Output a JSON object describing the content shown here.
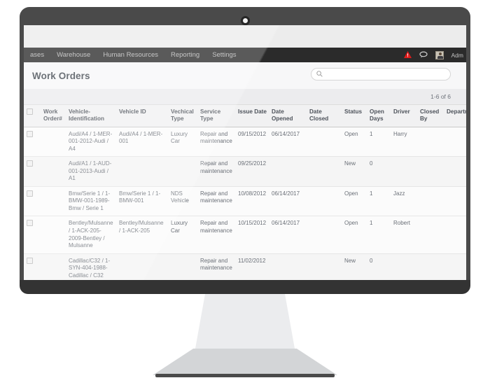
{
  "device": {
    "webcam_icon": "webcam-dot-icon"
  },
  "nav": {
    "items": [
      {
        "label": "ases"
      },
      {
        "label": "Warehouse"
      },
      {
        "label": "Human Resources"
      },
      {
        "label": "Reporting"
      },
      {
        "label": "Settings"
      }
    ],
    "right": {
      "warning_icon": "warning-triangle-icon",
      "warning_color": "#e01b1b",
      "chat_icon": "chat-bubble-icon",
      "avatar_icon": "user-avatar-icon",
      "user_label": "Adm"
    }
  },
  "page": {
    "title": "Work Orders",
    "search": {
      "icon": "search-icon",
      "value": "",
      "placeholder": ""
    },
    "pagination": "1-6 of 6"
  },
  "table": {
    "select_all_checkbox": "select-all-checkbox",
    "columns": [
      "",
      "Work Order#",
      "Vehicle-Identification",
      "Vehicle ID",
      "Vechical Type",
      "Service Type",
      "Issue Date",
      "Date Opened",
      "Date Closed",
      "Status",
      "Open Days",
      "Driver",
      "Closed By",
      "Department"
    ],
    "rows": [
      {
        "style": "open",
        "work_order": "",
        "vehicle_identification": "Audi/A4 / 1-MER-001-2012-Audi / A4",
        "vehicle_id": "Audi/A4 / 1-MER-001",
        "vehicle_type": "Luxury Car",
        "service_type": "Repair and maintenance",
        "issue_date": "09/15/2012",
        "date_opened": "06/14/2017",
        "date_closed": "",
        "status": "Open",
        "open_days": "1",
        "driver": "Harry",
        "closed_by": "",
        "department": ""
      },
      {
        "style": "new",
        "work_order": "",
        "vehicle_identification": "Audi/A1 / 1-AUD-001-2013-Audi / A1",
        "vehicle_id": "",
        "vehicle_type": "",
        "service_type": "Repair and maintenance",
        "issue_date": "09/25/2012",
        "date_opened": "",
        "date_closed": "",
        "status": "New",
        "open_days": "0",
        "driver": "",
        "closed_by": "",
        "department": ""
      },
      {
        "style": "open",
        "work_order": "",
        "vehicle_identification": "Bmw/Serie 1 / 1-BMW-001-1989-Bmw / Serie 1",
        "vehicle_id": "Bmw/Serie 1 / 1-BMW-001",
        "vehicle_type": "NDS Vehicle",
        "service_type": "Repair and maintenance",
        "issue_date": "10/08/2012",
        "date_opened": "06/14/2017",
        "date_closed": "",
        "status": "Open",
        "open_days": "1",
        "driver": "Jazz",
        "closed_by": "",
        "department": ""
      },
      {
        "style": "open",
        "work_order": "",
        "vehicle_identification": "Bentley/Mulsanne / 1-ACK-205-2009-Bentley / Mulsanne",
        "vehicle_id": "Bentley/Mulsanne / 1-ACK-205",
        "vehicle_type": "Luxury Car",
        "service_type": "Repair and maintenance",
        "issue_date": "10/15/2012",
        "date_opened": "06/14/2017",
        "date_closed": "",
        "status": "Open",
        "open_days": "1",
        "driver": "Robert",
        "closed_by": "",
        "department": ""
      },
      {
        "style": "new",
        "work_order": "",
        "vehicle_identification": "Cadillac/C32 / 1-SYN-404-1988-Cadillac / C32",
        "vehicle_id": "",
        "vehicle_type": "",
        "service_type": "Repair and maintenance",
        "issue_date": "11/02/2012",
        "date_opened": "",
        "date_closed": "",
        "status": "New",
        "open_days": "0",
        "driver": "",
        "closed_by": "",
        "department": ""
      }
    ]
  },
  "colors": {
    "link": "#4a5cd6",
    "nav_bg": "#2b2b2b",
    "bezel": "#4a4a4a",
    "page_bg": "#f7f7f8"
  }
}
